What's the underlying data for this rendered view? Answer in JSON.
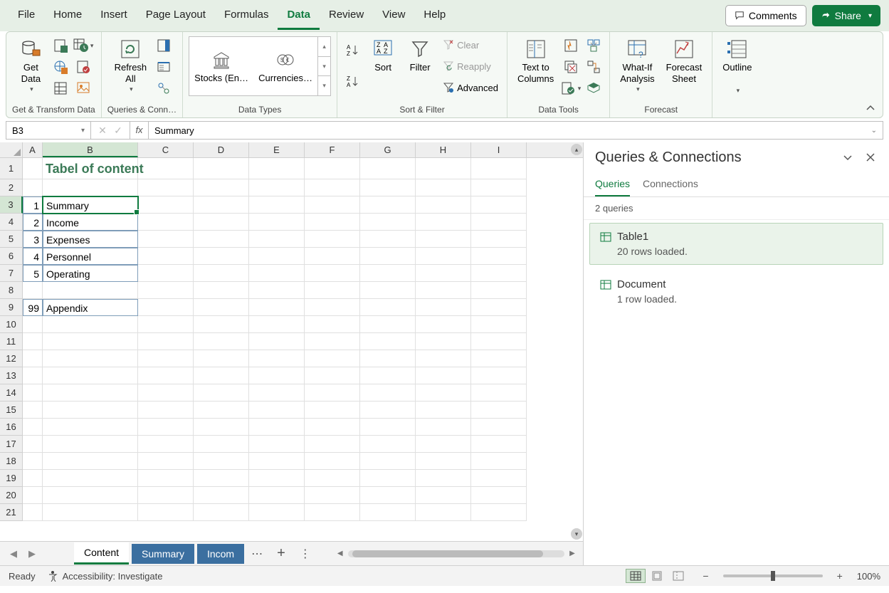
{
  "tabs": {
    "file": "File",
    "home": "Home",
    "insert": "Insert",
    "pageLayout": "Page Layout",
    "formulas": "Formulas",
    "data": "Data",
    "review": "Review",
    "view": "View",
    "help": "Help"
  },
  "topRight": {
    "comments": "Comments",
    "share": "Share"
  },
  "ribbon": {
    "getData": "Get\nData",
    "refreshAll": "Refresh\nAll",
    "stocks": "Stocks (En…",
    "currencies": "Currencies…",
    "sort": "Sort",
    "filter": "Filter",
    "clear": "Clear",
    "reapply": "Reapply",
    "advanced": "Advanced",
    "textToColumns": "Text to\nColumns",
    "whatIf": "What-If\nAnalysis",
    "forecastSheet": "Forecast\nSheet",
    "outline": "Outline",
    "groups": {
      "g1": "Get & Transform Data",
      "g2": "Queries & Conn…",
      "g3": "Data Types",
      "g4": "Sort & Filter",
      "g5": "Data Tools",
      "g6": "Forecast"
    }
  },
  "nameBox": "B3",
  "formula": "Summary",
  "columns": [
    "A",
    "B",
    "C",
    "D",
    "E",
    "F",
    "G",
    "H",
    "I"
  ],
  "rowNums": [
    1,
    2,
    3,
    4,
    5,
    6,
    7,
    8,
    9,
    10,
    11,
    12,
    13,
    14,
    15,
    16,
    17,
    18,
    19,
    20,
    21
  ],
  "cells": {
    "title": "Tabel of content",
    "toc": [
      {
        "n": "1",
        "t": "Summary"
      },
      {
        "n": "2",
        "t": "Income"
      },
      {
        "n": "3",
        "t": "Expenses"
      },
      {
        "n": "4",
        "t": "Personnel"
      },
      {
        "n": "5",
        "t": "Operating"
      }
    ],
    "appendix": {
      "n": "99",
      "t": "Appendix"
    }
  },
  "sheetTabs": {
    "content": "Content",
    "summary": "Summary",
    "income": "Incom"
  },
  "pane": {
    "title": "Queries & Connections",
    "tabQueries": "Queries",
    "tabConnections": "Connections",
    "count": "2 queries",
    "q1": {
      "name": "Table1",
      "status": "20 rows loaded."
    },
    "q2": {
      "name": "Document",
      "status": "1 row loaded."
    }
  },
  "status": {
    "ready": "Ready",
    "accessibility": "Accessibility: Investigate",
    "zoom": "100%"
  }
}
